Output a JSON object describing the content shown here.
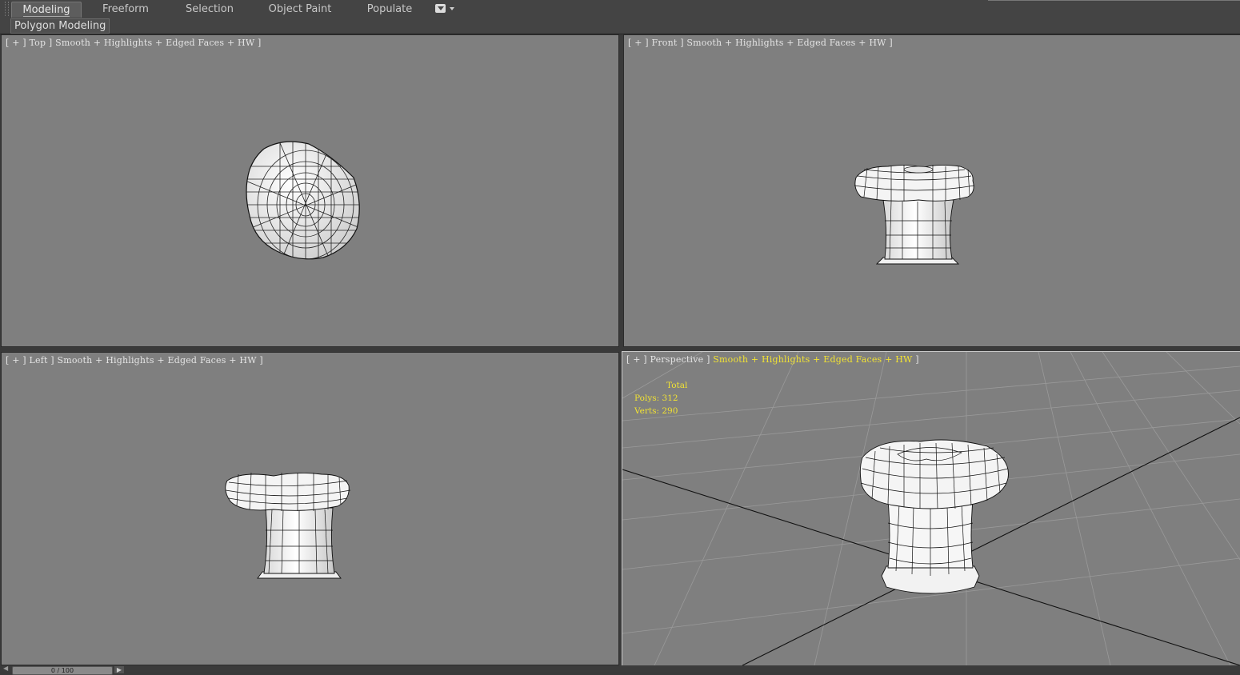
{
  "ribbon": {
    "tabs": [
      {
        "label": "Modeling",
        "active": true
      },
      {
        "label": "Freeform",
        "active": false
      },
      {
        "label": "Selection",
        "active": false
      },
      {
        "label": "Object Paint",
        "active": false
      },
      {
        "label": "Populate",
        "active": false
      }
    ],
    "panel_label": "Polygon Modeling"
  },
  "viewports": {
    "top": {
      "label": "[ + ] Top ] Smooth + Highlights + Edged Faces + HW ]"
    },
    "front": {
      "label": "[ + ] Front ] Smooth + Highlights + Edged Faces + HW ]"
    },
    "left": {
      "label": "[ + ] Left ] Smooth + Highlights + Edged Faces + HW ]"
    },
    "perspective": {
      "label_prefix": "[ + ] Perspective ] ",
      "label_highlight": "Smooth + Highlights + Edged Faces + HW",
      "label_suffix": " ]",
      "stats": {
        "title": "Total",
        "polys": "Polys: 312",
        "verts": "Verts: 290"
      }
    }
  },
  "timeline": {
    "position": "0 / 100"
  },
  "colors": {
    "viewport_bg": "#7f7f7f",
    "ui_dark": "#444444",
    "highlight_text": "#f1e233"
  }
}
